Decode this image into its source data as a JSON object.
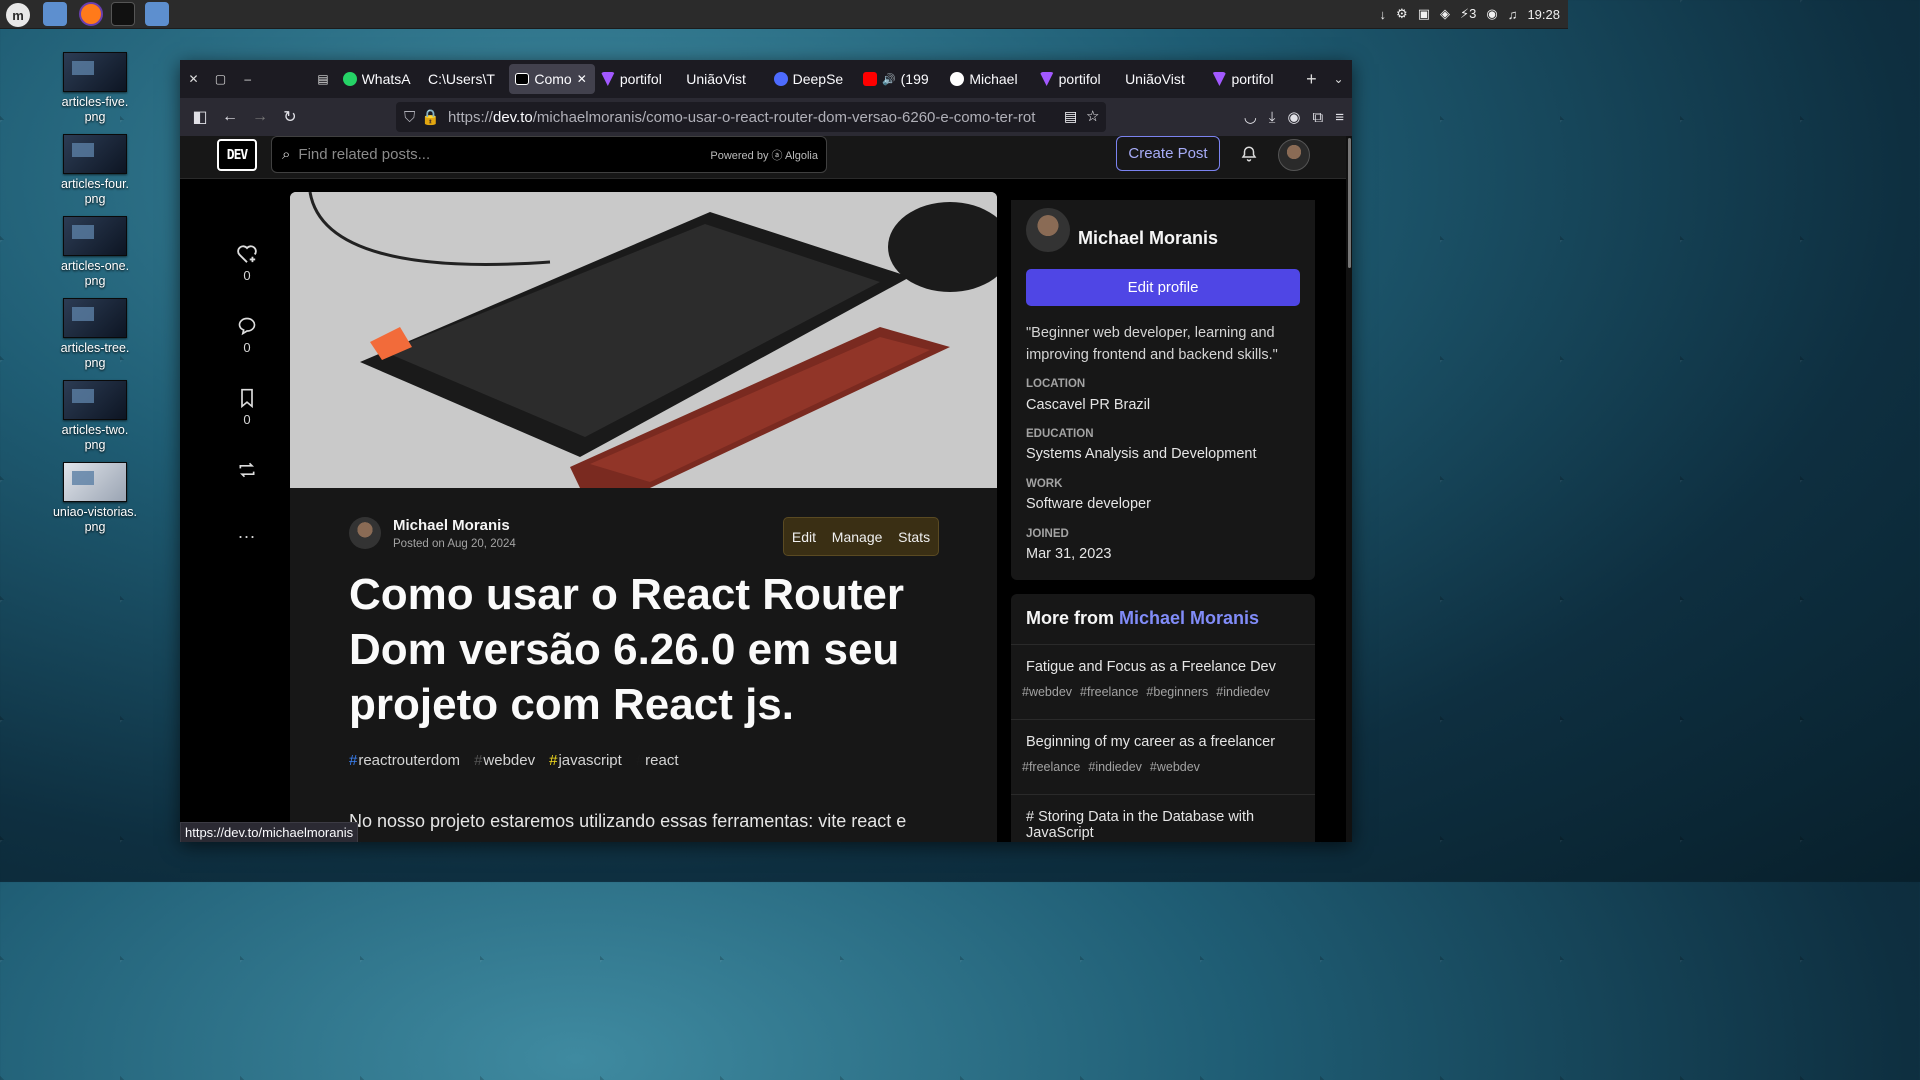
{
  "panel": {
    "tray": [
      "↓",
      "⚙",
      "▣",
      "◈",
      "⚡3",
      "◉",
      "♫",
      "19:28"
    ],
    "clock": "19:28"
  },
  "desktop": {
    "items": [
      {
        "label": "articles-five.\npng"
      },
      {
        "label": "articles-four.\npng"
      },
      {
        "label": "articles-one.\npng"
      },
      {
        "label": "articles-tree.\npng"
      },
      {
        "label": "articles-two.\npng"
      },
      {
        "label": "uniao-vistorias.\npng"
      }
    ]
  },
  "browser": {
    "tabs": [
      {
        "label": "WhatsA",
        "color": "#25d366"
      },
      {
        "label": "C:\\Users\\T",
        "color": ""
      },
      {
        "label": "Como",
        "color": "#ffffff",
        "active": true
      },
      {
        "label": "portifol",
        "color": "#a259ff"
      },
      {
        "label": "UniãoVist",
        "color": ""
      },
      {
        "label": "DeepSe",
        "color": "#4d6bfe"
      },
      {
        "label": "(199",
        "color": "#ff0000"
      },
      {
        "label": "Michael",
        "color": "#ffffff"
      },
      {
        "label": "portifol",
        "color": "#a259ff"
      },
      {
        "label": "UniãoVist",
        "color": ""
      },
      {
        "label": "portifol",
        "color": "#a259ff"
      }
    ],
    "url_prefix": "https://",
    "url_host": "dev.to",
    "url_path": "/michaelmoranis/como-usar-o-react-router-dom-versao-6260-e-como-ter-rot",
    "status_link": "https://dev.to/michaelmoranis"
  },
  "header": {
    "logo": "DEV",
    "search_placeholder": "Find related posts...",
    "powered_by": "Powered by ⓐ Algolia",
    "create_post": "Create Post"
  },
  "reactions": {
    "likes": "0",
    "comments": "0",
    "bookmarks": "0",
    "more": "..."
  },
  "article": {
    "author": "Michael Moranis",
    "posted": "Posted on Aug 20, 2024",
    "actions": {
      "edit": "Edit",
      "manage": "Manage",
      "stats": "Stats"
    },
    "title": "Como usar o React Router Dom versão 6.26.0 em seu projeto com React js.",
    "tags": [
      {
        "hash": "#",
        "name": "reactrouterdom",
        "color": "#3b82f6"
      },
      {
        "hash": "#",
        "name": "webdev",
        "color": "#555555"
      },
      {
        "hash": "#",
        "name": "javascript",
        "color": "#f7df1e"
      },
      {
        "hash": "#",
        "name": "react",
        "color": "#1a1a1a"
      }
    ],
    "body": "No nosso projeto estaremos utilizando essas ferramentas: vite react e"
  },
  "profile": {
    "name": "Michael Moranis",
    "edit_profile": "Edit profile",
    "bio": "\"Beginner web developer, learning and improving frontend and backend skills.\"",
    "location_label": "LOCATION",
    "location": "Cascavel PR Brazil",
    "education_label": "EDUCATION",
    "education": "Systems Analysis and Development",
    "work_label": "WORK",
    "work": "Software developer",
    "joined_label": "JOINED",
    "joined": "Mar 31, 2023"
  },
  "more_from": {
    "prefix": "More from ",
    "author": "Michael Moranis",
    "items": [
      {
        "title": "Fatigue and Focus as a Freelance Dev",
        "tags": [
          "#webdev",
          "#freelance",
          "#beginners",
          "#indiedev"
        ]
      },
      {
        "title": "Beginning of my career as a freelancer",
        "tags": [
          "#freelance",
          "#indiedev",
          "#webdev"
        ]
      },
      {
        "title": "# Storing Data in the Database with JavaScript",
        "tags": []
      }
    ]
  }
}
